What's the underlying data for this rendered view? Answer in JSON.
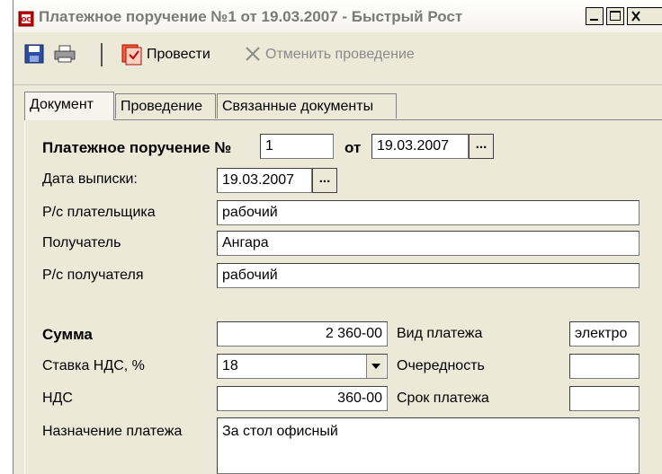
{
  "window": {
    "title": "Платежное поручение №1 от 19.03.2007 - Быстрый Рост",
    "app_icon": "document-icon",
    "controls": [
      "minimize",
      "maximize",
      "close"
    ]
  },
  "toolbar": {
    "save_icon": "save-icon",
    "print_icon": "print-icon",
    "post_label": "Провести",
    "post_icon": "post-document-icon",
    "cancel_post_label": "Отменить проведение",
    "cancel_post_icon": "close-x-icon"
  },
  "tabs": [
    {
      "label": "Документ",
      "active": true
    },
    {
      "label": "Проведение",
      "active": false
    },
    {
      "label": "Связанные документы",
      "active": false
    }
  ],
  "form": {
    "order_label": "Платежное поручение №",
    "order_number": "1",
    "from_label": "от",
    "order_date": "19.03.2007",
    "statement_date_label": "Дата выписки:",
    "statement_date": "19.03.2007",
    "ellipsis": "...",
    "payer_account_label": "Р/с плательщика",
    "payer_account": "рабочий",
    "recipient_label": "Получатель",
    "recipient": "Ангара",
    "recipient_account_label": "Р/с получателя",
    "recipient_account": "рабочий",
    "sum_label": "Сумма",
    "sum": "2 360-00",
    "payment_type_label": "Вид платежа",
    "payment_type": "электро",
    "vat_rate_label": "Ставка НДС, %",
    "vat_rate": "18",
    "priority_label": "Очередность",
    "priority": "",
    "vat_label": "НДС",
    "vat": "360-00",
    "due_label": "Срок платежа",
    "due": "",
    "purpose_label": "Назначение платежа",
    "purpose": "За стол офисный"
  }
}
